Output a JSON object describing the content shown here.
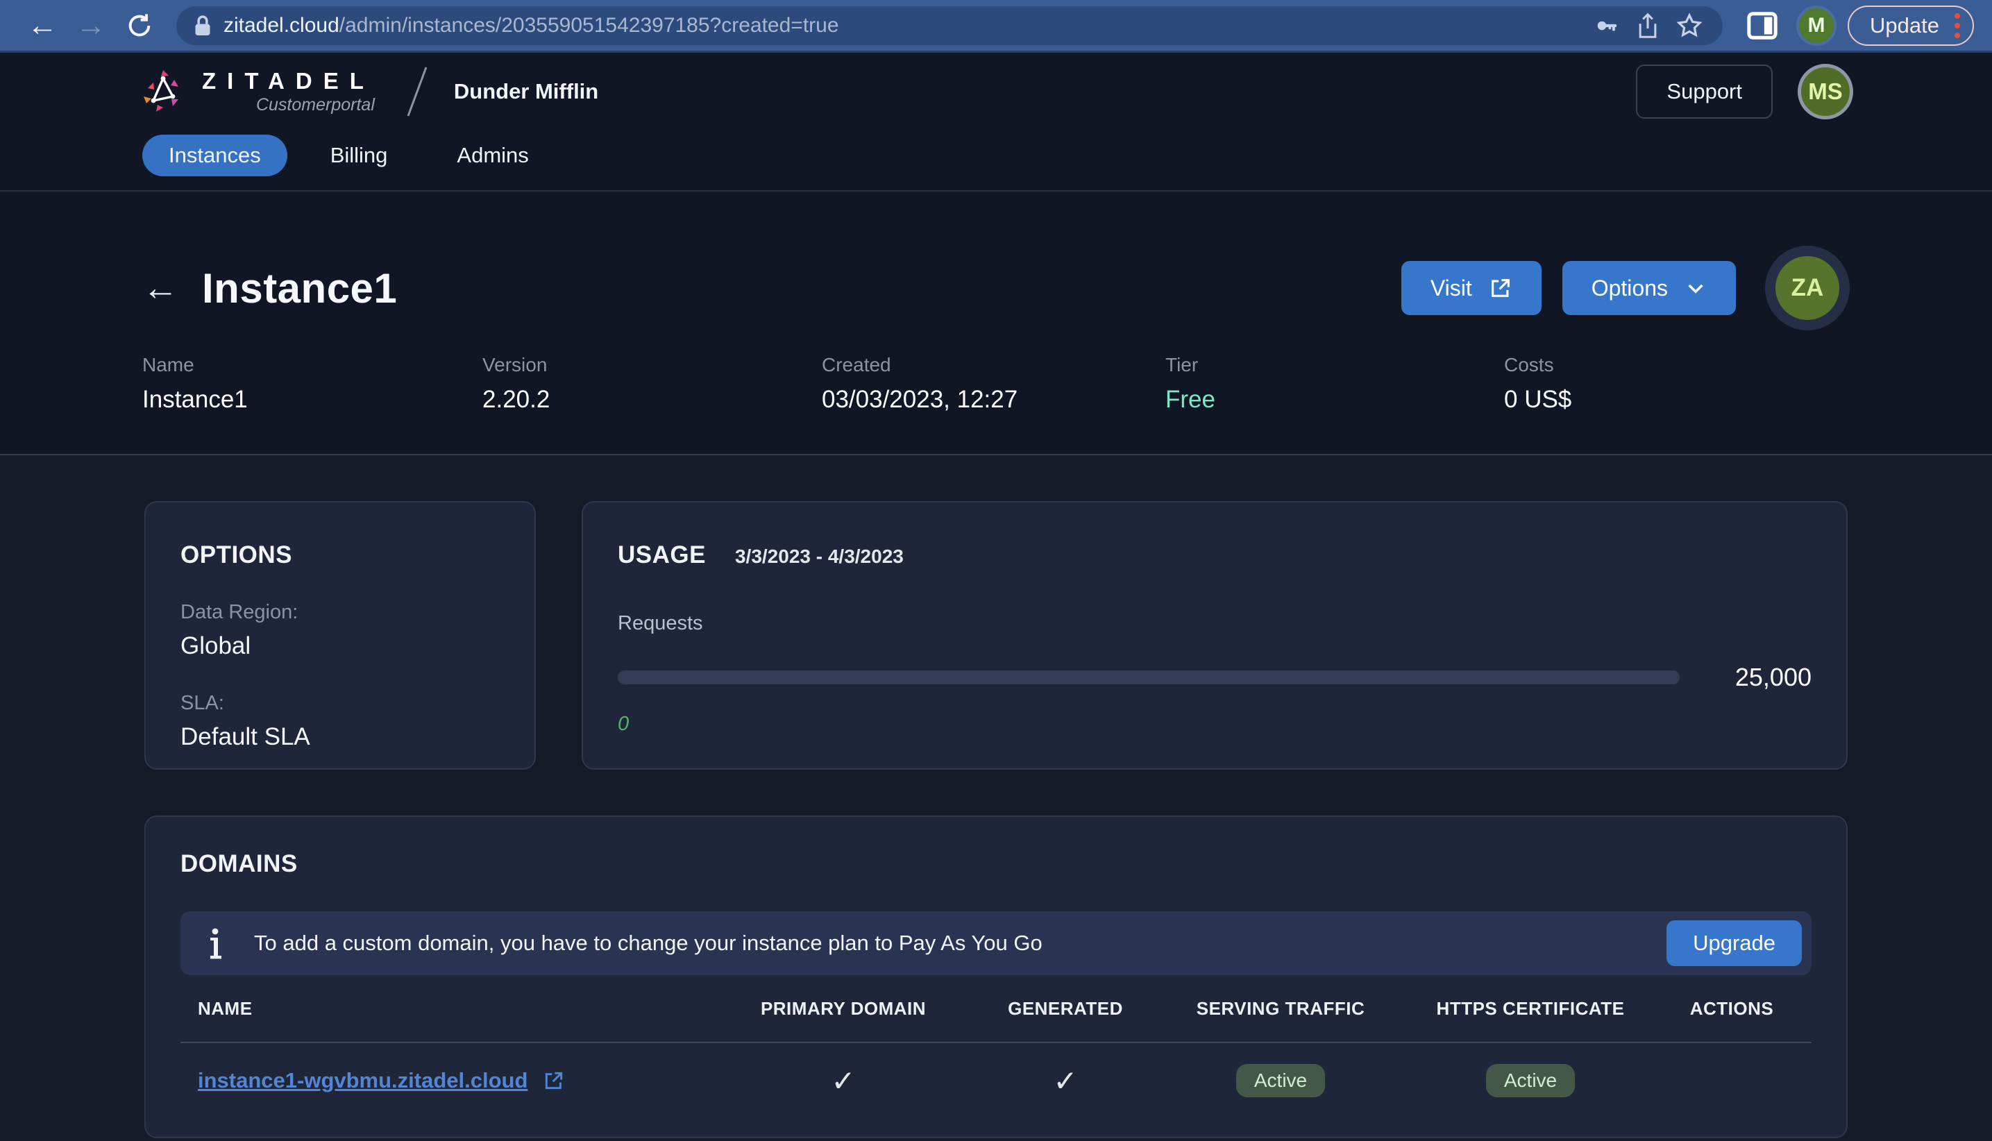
{
  "browser": {
    "url_domain": "zitadel.cloud",
    "url_path": "/admin/instances/203559051542397185?created=true",
    "update_label": "Update",
    "profile_initial": "M"
  },
  "header": {
    "brand_name": "ZITADEL",
    "brand_sub": "Customerportal",
    "org_name": "Dunder Mifflin",
    "support_label": "Support",
    "user_initials": "MS",
    "tabs": [
      {
        "label": "Instances",
        "active": true
      },
      {
        "label": "Billing",
        "active": false
      },
      {
        "label": "Admins",
        "active": false
      }
    ]
  },
  "hero": {
    "title": "Instance1",
    "visit_label": "Visit",
    "options_label": "Options",
    "instance_initials": "ZA",
    "meta": [
      {
        "label": "Name",
        "value": "Instance1"
      },
      {
        "label": "Version",
        "value": "2.20.2"
      },
      {
        "label": "Created",
        "value": "03/03/2023, 12:27"
      },
      {
        "label": "Tier",
        "value": "Free"
      },
      {
        "label": "Costs",
        "value": "0 US$"
      }
    ]
  },
  "options_card": {
    "title": "OPTIONS",
    "fields": [
      {
        "label": "Data Region:",
        "value": "Global"
      },
      {
        "label": "SLA:",
        "value": "Default SLA"
      }
    ]
  },
  "usage_card": {
    "title": "USAGE",
    "period": "3/3/2023 - 4/3/2023",
    "metric_label": "Requests",
    "current": "0",
    "limit": "25,000",
    "progress_percent": 0
  },
  "domains_card": {
    "title": "DOMAINS",
    "notice": "To add a custom domain, you have to change your instance plan to Pay As You Go",
    "upgrade_label": "Upgrade",
    "table": {
      "headers": [
        "NAME",
        "PRIMARY DOMAIN",
        "GENERATED",
        "SERVING TRAFFIC",
        "HTTPS CERTIFICATE",
        "ACTIONS"
      ],
      "row": {
        "name": "instance1-wgvbmu.zitadel.cloud",
        "primary_domain": "✓",
        "generated": "✓",
        "serving_traffic": "Active",
        "https_certificate": "Active"
      }
    }
  },
  "colors": {
    "primary_blue": "#3777cb",
    "tier_mint": "#7fe7c3",
    "usage_green": "#52b365",
    "link_blue": "#5285d6",
    "badge_bg": "#44584a",
    "badge_text": "#cff0d2",
    "card_bg": "#1f2639",
    "header_bg": "#101624",
    "page_bg": "#141a28",
    "browser_bar": "#3a5d95"
  }
}
